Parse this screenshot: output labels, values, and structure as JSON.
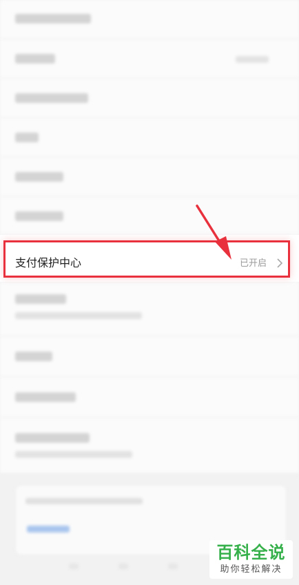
{
  "settings_item": {
    "title": "支付保护中心",
    "status": "已开启"
  },
  "watermark": {
    "title": "百科全说",
    "subtitle": "助你轻松解决"
  },
  "colors": {
    "highlight": "#e8313c",
    "watermark_green": "#35b04a",
    "status_gray": "#9a9a9a"
  },
  "icons": [
    "chevron-right-icon",
    "annotation-arrow-icon"
  ]
}
